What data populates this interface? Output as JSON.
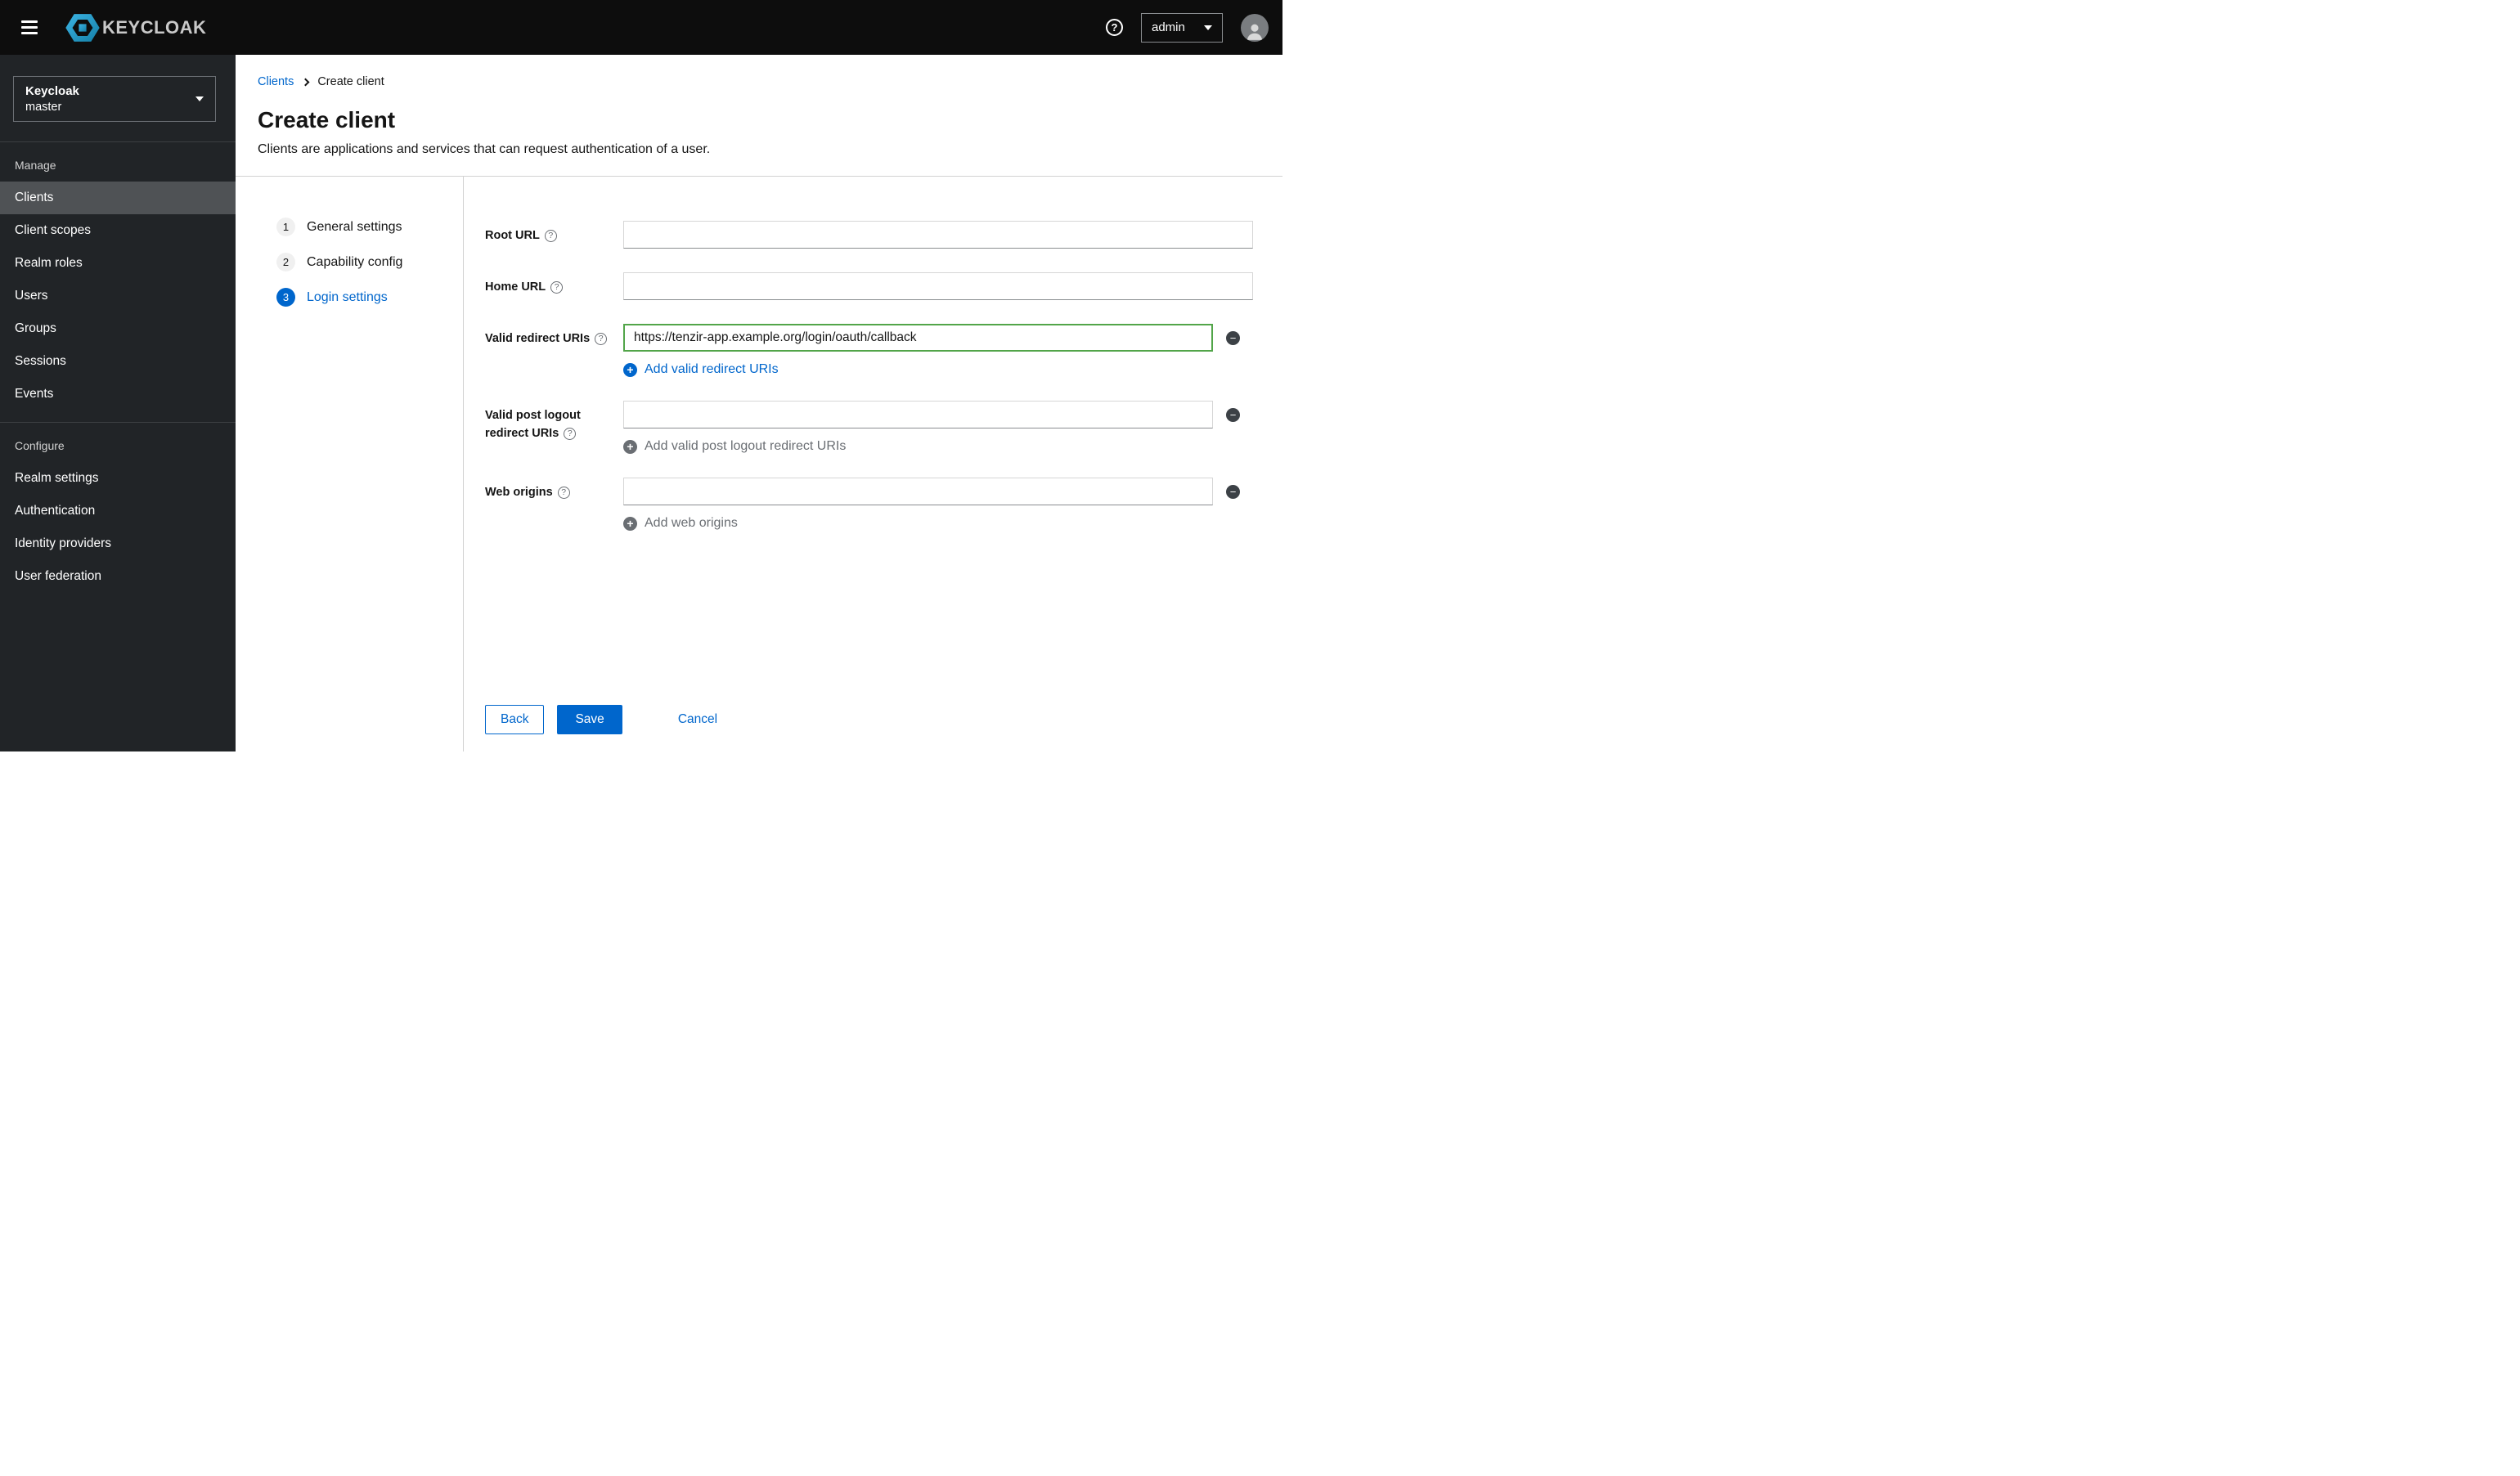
{
  "header": {
    "brand": "KEYCLOAK",
    "user": "admin"
  },
  "sidebar": {
    "realm_name": "Keycloak",
    "realm_current": "master",
    "sections": [
      {
        "title": "Manage",
        "items": [
          "Clients",
          "Client scopes",
          "Realm roles",
          "Users",
          "Groups",
          "Sessions",
          "Events"
        ]
      },
      {
        "title": "Configure",
        "items": [
          "Realm settings",
          "Authentication",
          "Identity providers",
          "User federation"
        ]
      }
    ]
  },
  "breadcrumb": {
    "parent": "Clients",
    "current": "Create client"
  },
  "page": {
    "title": "Create client",
    "subtitle": "Clients are applications and services that can request authentication of a user."
  },
  "wizard": {
    "steps": [
      {
        "num": "1",
        "label": "General settings"
      },
      {
        "num": "2",
        "label": "Capability config"
      },
      {
        "num": "3",
        "label": "Login settings"
      }
    ]
  },
  "form": {
    "root_url": {
      "label": "Root URL",
      "value": ""
    },
    "home_url": {
      "label": "Home URL",
      "value": ""
    },
    "redirect": {
      "label": "Valid redirect URIs",
      "value": "https://tenzir-app.example.org/login/oauth/callback",
      "add": "Add valid redirect URIs"
    },
    "post_logout": {
      "label": "Valid post logout redirect URIs",
      "value": "",
      "add": "Add valid post logout redirect URIs"
    },
    "web_origins": {
      "label": "Web origins",
      "value": "",
      "add": "Add web origins"
    }
  },
  "actions": {
    "back": "Back",
    "save": "Save",
    "cancel": "Cancel"
  },
  "colors": {
    "accent": "#0066cc",
    "focus_green": "#52a549",
    "header_bg": "#0d0d0d",
    "sidebar_bg": "#212427",
    "active_item_bg": "#4f5255"
  }
}
